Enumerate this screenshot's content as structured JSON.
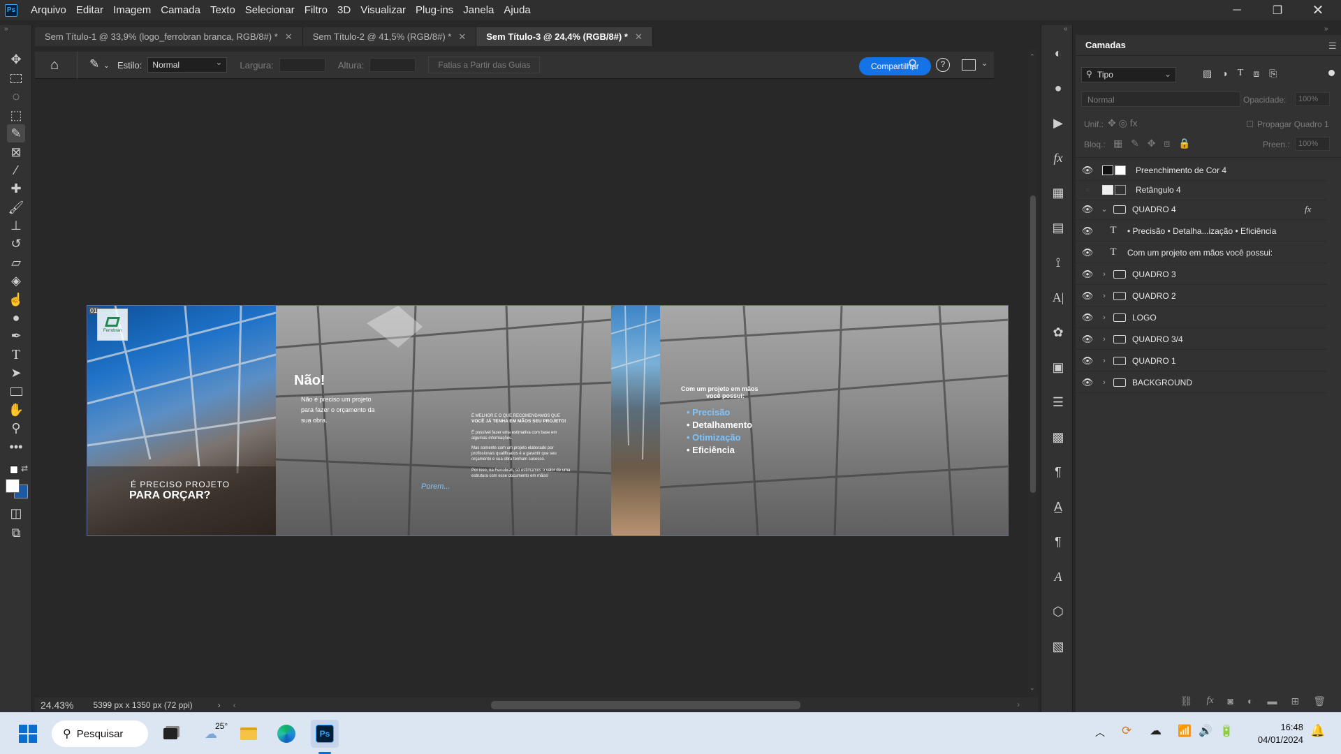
{
  "app": {
    "icon": "Ps",
    "menu": [
      "Arquivo",
      "Editar",
      "Imagem",
      "Camada",
      "Texto",
      "Selecionar",
      "Filtro",
      "3D",
      "Visualizar",
      "Plug-ins",
      "Janela",
      "Ajuda"
    ]
  },
  "tabs": [
    {
      "label": "Sem Título-1 @ 33,9% (logo_ferrobran branca, RGB/8#) *",
      "active": false
    },
    {
      "label": "Sem Título-2 @ 41,5% (RGB/8#) *",
      "active": false
    },
    {
      "label": "Sem Título-3 @ 24,4% (RGB/8#) *",
      "active": true
    }
  ],
  "options": {
    "style_label": "Estilo:",
    "style_value": "Normal",
    "width_label": "Largura:",
    "height_label": "Altura:",
    "slices_button": "Fatias a Partir das Guias",
    "share_button": "Compartilhar"
  },
  "document": {
    "panel1": {
      "badge": "01",
      "logo_text": "Ferrobran",
      "line1": "É PRECISO PROJETO",
      "line2": "PARA ORÇAR?"
    },
    "panel2": {
      "heading": "Não!",
      "body": "Não é preciso um projeto para fazer o orçamento da sua obra.",
      "porem": "Porem...",
      "small_heading_1": "É MELHOR E O QUE RECOMENDAMOS QUE",
      "small_heading_2": "VOCÊ JÁ TENHA EM MÃOS SEU PROJETO!",
      "small_p1": "É possível fazer uma estimativa com base em algumas informações.",
      "small_p2": "Mas somente com um projeto elaborado por profissionais qualificados é a garantir que seu orçamento e sua obra tenham sucesso.",
      "small_p3": "Por isso, na Ferrobran, só estimamos o valor de uma estrutura com esse documento em mãos!"
    },
    "panel4": {
      "heading_1": "Com um projeto em mãos",
      "heading_2": "você possui:",
      "items": [
        "• Precisão",
        "• Detalhamento",
        "• Otimização",
        "• Eficiência"
      ]
    }
  },
  "status": {
    "zoom": "24.43%",
    "doc_size": "5399 px x 1350 px (72 ppi)"
  },
  "layers_panel": {
    "title": "Camadas",
    "filter": "Tipo",
    "blend_mode": "Normal",
    "opacity_label": "Opacidade:",
    "opacity_value": "100%",
    "unify_label": "Unif.:",
    "propagate_label": "Propagar Quadro 1",
    "lock_label": "Bloq.:",
    "fill_label": "Preen.:",
    "fill_value": "100%",
    "layers": [
      {
        "name": "Preenchimento de Cor 4",
        "kind": "fill",
        "visible": true
      },
      {
        "name": "Retângulo 4",
        "kind": "shape",
        "visible": false
      },
      {
        "name": "QUADRO 4",
        "kind": "group-open",
        "visible": true,
        "fx": "fx"
      },
      {
        "name": "• Precisão • Detalha...ização • Eficiência",
        "kind": "text",
        "visible": true
      },
      {
        "name": "Com um projeto em mãos  você possui:",
        "kind": "text",
        "visible": true
      },
      {
        "name": "QUADRO 3",
        "kind": "group",
        "visible": true
      },
      {
        "name": "QUADRO 2",
        "kind": "group",
        "visible": true
      },
      {
        "name": "LOGO",
        "kind": "group",
        "visible": true
      },
      {
        "name": "QUADRO 3/4",
        "kind": "group",
        "visible": true
      },
      {
        "name": "QUADRO 1",
        "kind": "group",
        "visible": true
      },
      {
        "name": "BACKGROUND",
        "kind": "group",
        "visible": true
      }
    ]
  },
  "taskbar": {
    "search": "Pesquisar",
    "weather": "25°",
    "time": "16:48",
    "date": "04/01/2024"
  },
  "colors": {
    "accent": "#1473e6",
    "text_blue": "#7ec4ff",
    "bg": "#282828"
  }
}
